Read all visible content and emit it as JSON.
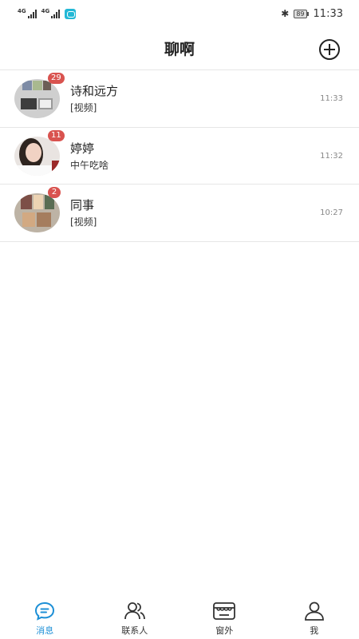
{
  "status_bar": {
    "network_1": "4G",
    "network_2": "4G",
    "battery": "89",
    "time": "11:33"
  },
  "header": {
    "title": "聊啊",
    "add_icon": "plus-circle-icon"
  },
  "chats": [
    {
      "name": "诗和远方",
      "preview": "[视频]",
      "time": "11:33",
      "unread": "29"
    },
    {
      "name": "婷婷",
      "preview": "中午吃啥",
      "time": "11:32",
      "unread": "11"
    },
    {
      "name": "同事",
      "preview": "[视频]",
      "time": "10:27",
      "unread": "2"
    }
  ],
  "nav": {
    "messages": "消息",
    "contacts": "联系人",
    "window": "窗外",
    "me": "我"
  },
  "colors": {
    "accent": "#1c8fd6",
    "badge": "#d9534f",
    "divider": "#e6e6e6"
  }
}
